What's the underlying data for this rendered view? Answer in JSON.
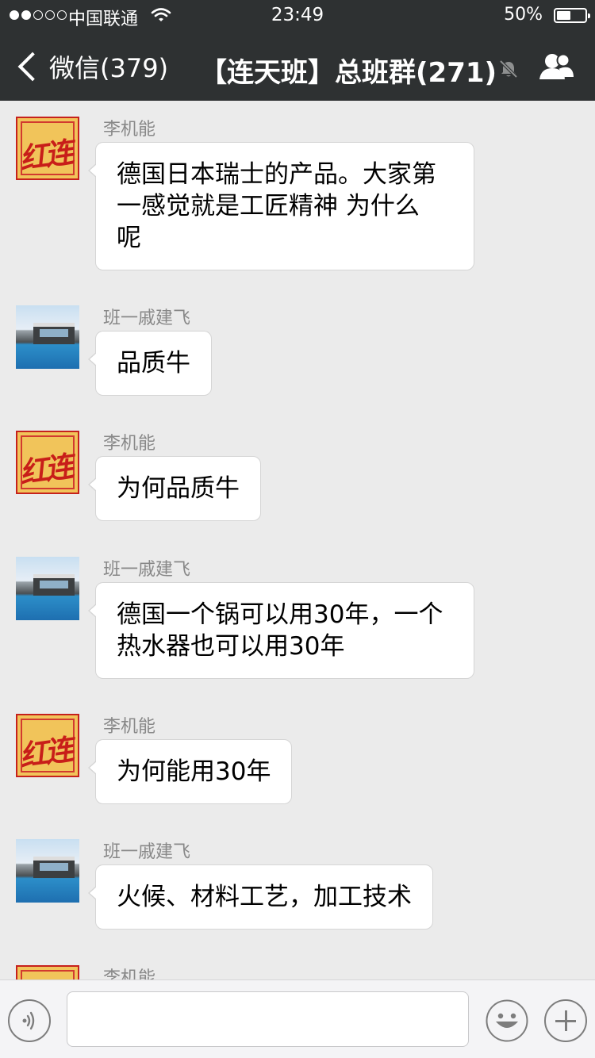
{
  "status_bar": {
    "carrier": "中国联通",
    "time": "23:49",
    "battery": "50%",
    "battery_level": 0.5,
    "signal_dots": [
      true,
      true,
      false,
      false,
      false
    ]
  },
  "nav": {
    "back_label": "微信(379)",
    "title": "【连天班】总班群(271)",
    "icons": [
      "back-chevron-icon",
      "mute-bell-icon",
      "group-members-icon"
    ]
  },
  "avatars": {
    "li_jineng": {
      "text": "红连天",
      "bg": "#f1c45a",
      "fg": "#c81e19"
    },
    "ban_qi": {
      "icon": "villa-photo",
      "bg": "#2c8ec9"
    }
  },
  "messages": [
    {
      "sender": "李机能",
      "avatar": "li_jineng",
      "lines": [
        "德国日本瑞士的产品。大家第",
        "一感觉就是工匠精神  为什么",
        "呢"
      ]
    },
    {
      "sender": "班一戚建飞",
      "avatar": "ban_qi",
      "lines": [
        "品质牛"
      ]
    },
    {
      "sender": "李机能",
      "avatar": "li_jineng",
      "lines": [
        "为何品质牛"
      ]
    },
    {
      "sender": "班一戚建飞",
      "avatar": "ban_qi",
      "lines": [
        "德国一个锅可以用30年，一个",
        "热水器也可以用30年"
      ]
    },
    {
      "sender": "李机能",
      "avatar": "li_jineng",
      "lines": [
        "为何能用30年"
      ]
    },
    {
      "sender": "班一戚建飞",
      "avatar": "ban_qi",
      "lines": [
        "火候、材料工艺，加工技术"
      ]
    },
    {
      "sender": "李机能",
      "avatar": "li_jineng",
      "lines": []
    }
  ],
  "input_bar": {
    "text": "",
    "icons": [
      "voice-icon",
      "emoji-icon",
      "plus-icon"
    ]
  }
}
